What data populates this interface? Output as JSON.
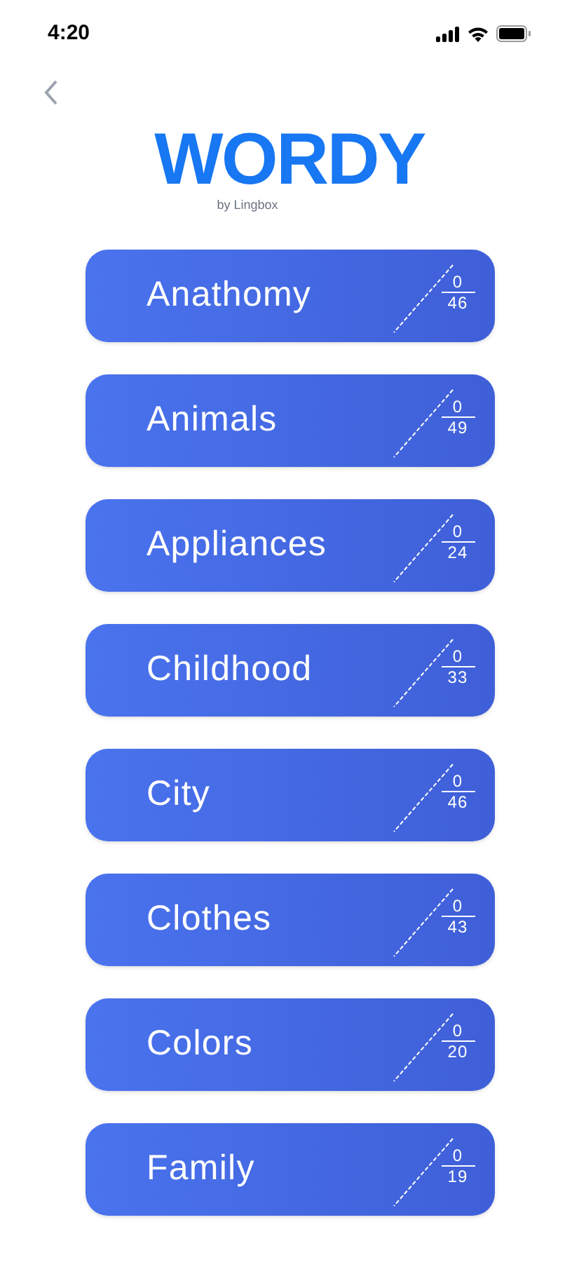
{
  "status_bar": {
    "time": "4:20"
  },
  "logo": {
    "title": "WORDY",
    "subtitle": "by Lingbox"
  },
  "categories": [
    {
      "name": "Anathomy",
      "done": "0",
      "total": "46"
    },
    {
      "name": "Animals",
      "done": "0",
      "total": "49"
    },
    {
      "name": "Appliances",
      "done": "0",
      "total": "24"
    },
    {
      "name": "Childhood",
      "done": "0",
      "total": "33"
    },
    {
      "name": "City",
      "done": "0",
      "total": "46"
    },
    {
      "name": "Clothes",
      "done": "0",
      "total": "43"
    },
    {
      "name": "Colors",
      "done": "0",
      "total": "20"
    },
    {
      "name": "Family",
      "done": "0",
      "total": "19"
    }
  ]
}
